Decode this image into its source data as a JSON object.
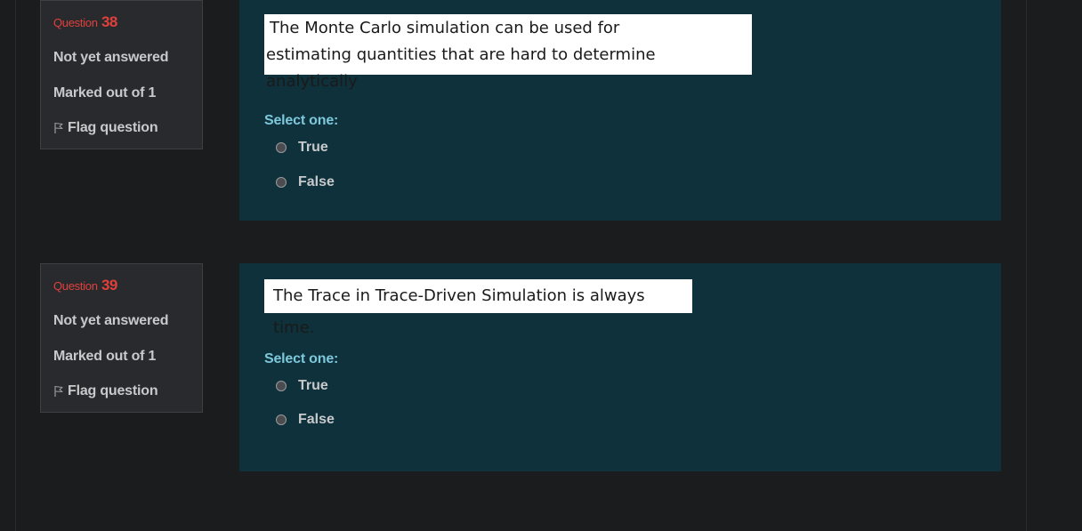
{
  "questions": [
    {
      "label": "Question",
      "number": "38",
      "state": "Not yet answered",
      "grade": "Marked out of 1",
      "flag_label": "Flag question",
      "text_lines": [
        "The Monte Carlo simulation can be used for",
        "estimating quantities that are hard to determine analytically"
      ],
      "prompt": "Select one:",
      "options": [
        "True",
        "False"
      ]
    },
    {
      "label": "Question",
      "number": "39",
      "state": "Not yet answered",
      "grade": "Marked out of 1",
      "flag_label": "Flag question",
      "text_lines": [
        "The Trace in Trace-Driven Simulation is always time."
      ],
      "prompt": "Select one:",
      "options": [
        "True",
        "False"
      ]
    }
  ],
  "icons": {
    "flag": "flag-icon"
  },
  "colors": {
    "background": "#1b1c1e",
    "info_panel": "#282a2d",
    "content_panel": "#0e313b",
    "question_number": "#e0403c",
    "prompt": "#7ec8dc"
  }
}
